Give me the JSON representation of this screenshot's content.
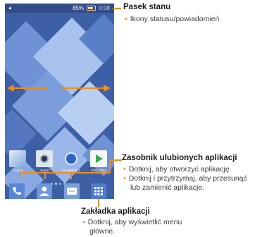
{
  "status_bar": {
    "battery_percent": "85%",
    "time": "0:08"
  },
  "favorites_apps": [
    {
      "label": "Galeria",
      "icon": "gallery-icon"
    },
    {
      "label": "Aparat",
      "icon": "camera-icon"
    },
    {
      "label": "Przeglądarka",
      "icon": "browser-icon"
    },
    {
      "label": "Sklep Play",
      "icon": "play-store-icon"
    }
  ],
  "dock_icons": [
    "phone-icon",
    "contacts-icon",
    "messages-icon",
    "apps-grid-icon"
  ],
  "callouts": {
    "status": {
      "title": "Pasek stanu",
      "items": [
        "Ikony statusu/powiadomień"
      ]
    },
    "favorites": {
      "title": "Zasobnik ulubionych aplikacji",
      "items": [
        "Dotknij, aby otworzyć aplikację.",
        "Dotknij i przytrzymaj, aby przesunąć",
        "lub zamienić aplikacje."
      ]
    },
    "apps_tab": {
      "title": "Zakładka aplikacji",
      "items": [
        "Dotknij, aby wyświetlić menu",
        "główne."
      ]
    }
  },
  "colors": {
    "accent": "#f08c1c",
    "wallpaper": "#3d5fa6",
    "wallpaper_light": "#8fb0e8"
  }
}
